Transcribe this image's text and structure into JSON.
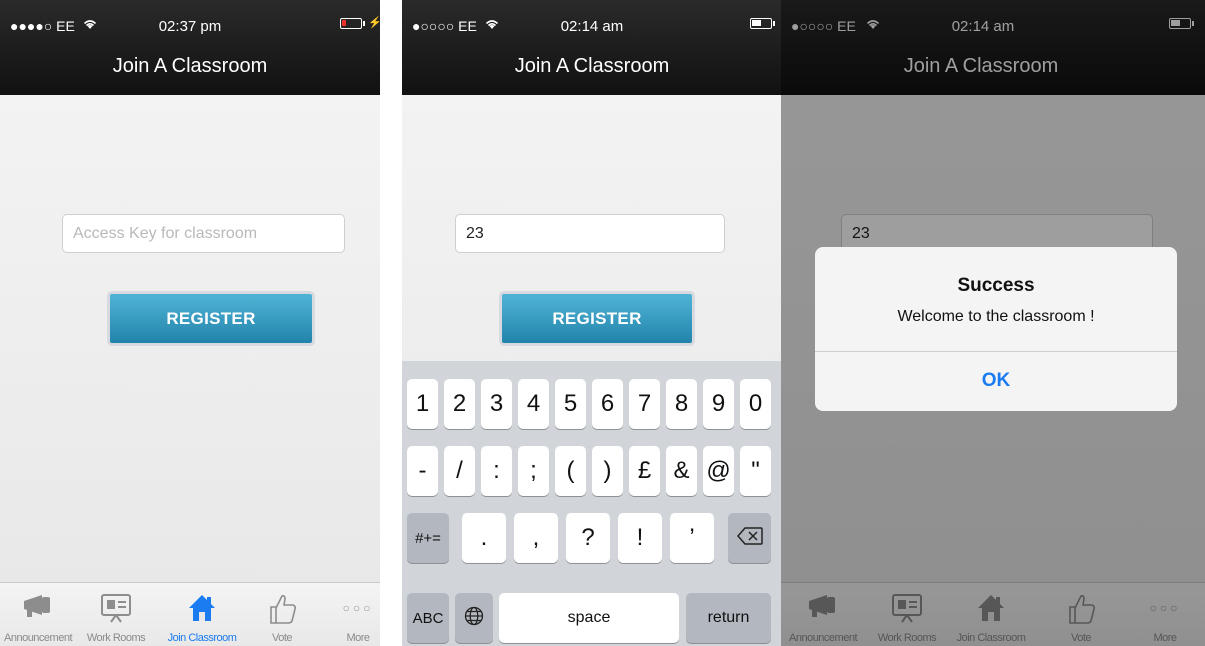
{
  "screens": [
    {
      "status": {
        "carrier": "●●●●○ EE",
        "time": "02:37 pm",
        "battery_level": 0.15,
        "battery_color": "#e8322b"
      },
      "nav_title": "Join A Classroom",
      "access_key": {
        "placeholder": "Access Key for classroom",
        "value": ""
      },
      "register_label": "REGISTER",
      "tabs": [
        {
          "label": "Announcement",
          "icon": "megaphone-icon"
        },
        {
          "label": "Work Rooms",
          "icon": "presentation-board-icon"
        },
        {
          "label": "Join Classroom",
          "icon": "house-icon",
          "active": true
        },
        {
          "label": "Vote",
          "icon": "thumbs-up-icon"
        },
        {
          "label": "More",
          "icon": "more-dots-icon"
        }
      ]
    },
    {
      "status": {
        "carrier": "●○○○○ EE",
        "time": "02:14 am",
        "battery_level": 0.5
      },
      "nav_title": "Join A Classroom",
      "access_key": {
        "value": "23"
      },
      "register_label": "REGISTER",
      "keyboard": {
        "row1": [
          "1",
          "2",
          "3",
          "4",
          "5",
          "6",
          "7",
          "8",
          "9",
          "0"
        ],
        "row2": [
          "-",
          "/",
          ":",
          ";",
          "(",
          ")",
          "£",
          "&",
          "@",
          "\""
        ],
        "row3": [
          ".",
          ",",
          "?",
          "!",
          "’"
        ],
        "symbols_toggle": "#+=",
        "letters_toggle": "ABC",
        "space": "space",
        "return": "return"
      }
    },
    {
      "status": {
        "carrier": "●○○○○ EE",
        "time": "02:14 am",
        "battery_level": 0.5
      },
      "nav_title": "Join A Classroom",
      "access_key": {
        "value": "23"
      },
      "tabs": [
        {
          "label": "Announcement",
          "icon": "megaphone-icon"
        },
        {
          "label": "Work Rooms",
          "icon": "presentation-board-icon"
        },
        {
          "label": "Join Classroom",
          "icon": "house-icon"
        },
        {
          "label": "Vote",
          "icon": "thumbs-up-icon"
        },
        {
          "label": "More",
          "icon": "more-dots-icon"
        }
      ],
      "alert": {
        "title": "Success",
        "message": "Welcome to the classroom !",
        "ok_label": "OK"
      }
    }
  ],
  "colors": {
    "accent": "#1a7cf0",
    "register_button": "#2f97c1",
    "navbar": "#1a1a1a"
  }
}
